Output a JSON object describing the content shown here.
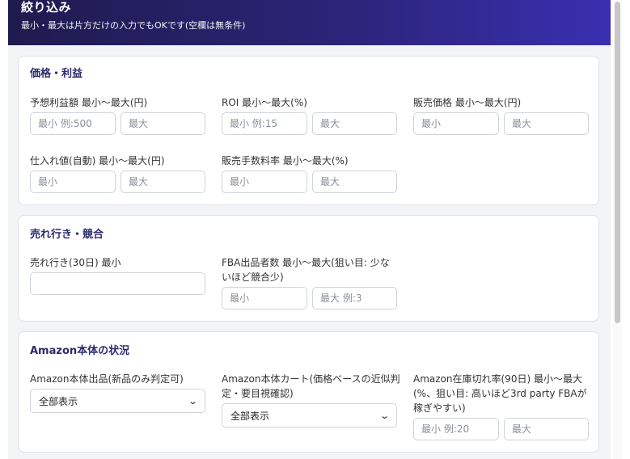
{
  "header": {
    "title": "絞り込み",
    "subtitle": "最小・最大は片方だけの入力でもOKです(空欄は無条件)"
  },
  "sections": {
    "price": {
      "title": "価格・利益",
      "expected_profit": {
        "label": "予想利益額 最小〜最大(円)",
        "min_placeholder": "最小 例:500",
        "max_placeholder": "最大"
      },
      "roi": {
        "label": "ROI 最小〜最大(%)",
        "min_placeholder": "最小 例:15",
        "max_placeholder": "最大"
      },
      "sale_price": {
        "label": "販売価格 最小〜最大(円)",
        "min_placeholder": "最小",
        "max_placeholder": "最大"
      },
      "cost": {
        "label": "仕入れ値(自動) 最小〜最大(円)",
        "min_placeholder": "最小",
        "max_placeholder": "最大"
      },
      "fee_rate": {
        "label": "販売手数料率 最小〜最大(%)",
        "min_placeholder": "最小",
        "max_placeholder": "最大"
      }
    },
    "sales": {
      "title": "売れ行き・競合",
      "sales30": {
        "label": "売れ行き(30日) 最小",
        "value": ""
      },
      "fba_sellers": {
        "label_line1": "FBA出品者数 最小〜最大(狙い目: 少な",
        "label_line2": "いほど競合少)",
        "min_placeholder": "最小",
        "max_placeholder": "最大 例:3"
      }
    },
    "amazon": {
      "title": "Amazon本体の状況",
      "amazon_listing": {
        "label": "Amazon本体出品(新品のみ判定可)",
        "selected": "全部表示"
      },
      "amazon_cart": {
        "label_line1": "Amazon本体カート(価格ベースの近似判",
        "label_line2": "定・要目視確認)",
        "selected": "全部表示"
      },
      "stockout": {
        "label_line1": "Amazon在庫切れ率(90日) 最小〜最大",
        "label_line2": "(%、狙い目: 高いほど3rd party FBAが",
        "label_line3": "稼ぎやすい)",
        "min_placeholder": "最小 例:20",
        "max_placeholder": "最大"
      }
    }
  },
  "icons": {
    "select_arrow": "chevron-down-icon"
  },
  "colors": {
    "header_start": "#1f1b4e",
    "header_end": "#3a2fb0",
    "section_title": "#2a2a6e"
  }
}
